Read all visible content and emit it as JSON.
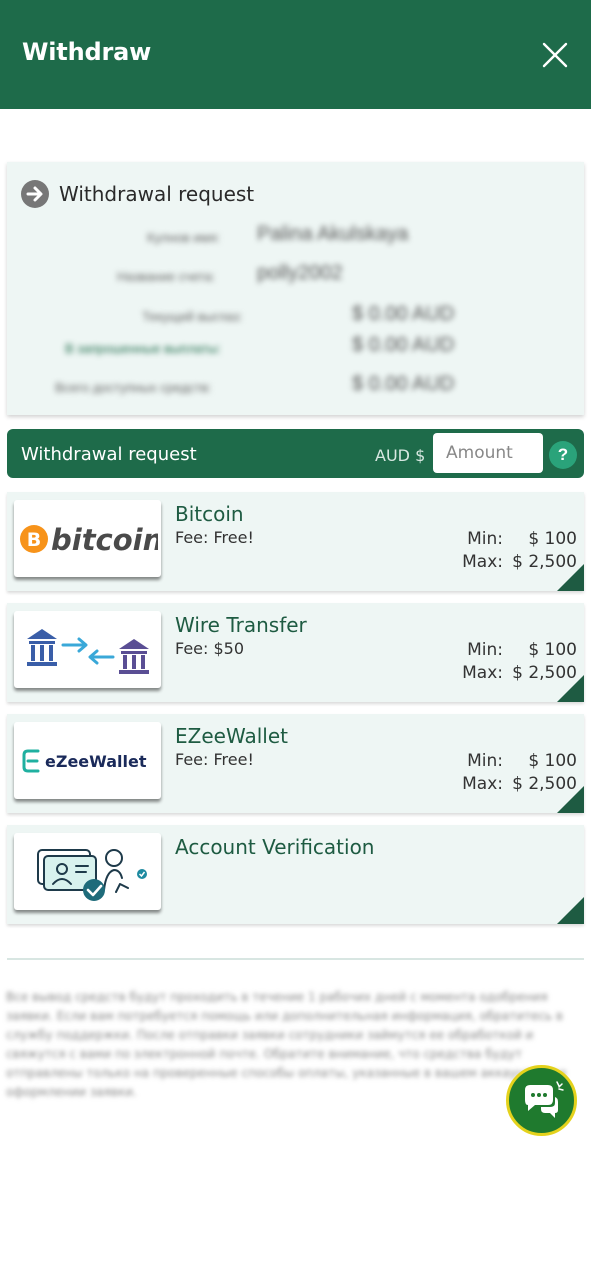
{
  "header": {
    "title": "Withdraw",
    "close_icon": "close-icon"
  },
  "summary": {
    "title": "Withdrawal request",
    "icon": "arrow-right-circle-icon",
    "rows": [
      {
        "label": "Кулнов имя:",
        "value": "Palina Akulskaya"
      },
      {
        "label": "Название счета:",
        "value": "polly2002"
      },
      {
        "label": "Текущий выглаз:",
        "value": "$ 0.00 AUD"
      },
      {
        "label": "В запрошенные выплаты:",
        "value": "$ 0.00 AUD"
      },
      {
        "label": "Всего доступных средств:",
        "value": "$ 0.00 AUD"
      }
    ]
  },
  "request_bar": {
    "label": "Withdrawal request",
    "currency": "AUD $",
    "amount_placeholder": "Amount",
    "help": "?"
  },
  "methods": [
    {
      "name": "Bitcoin",
      "fee": "Fee: Free!",
      "min_label": "Min:",
      "min": "$ 100",
      "max_label": "Max:",
      "max": "$ 2,500",
      "logo": "bitcoin-logo"
    },
    {
      "name": "Wire Transfer",
      "fee": "Fee: $50",
      "min_label": "Min:",
      "min": "$ 100",
      "max_label": "Max:",
      "max": "$ 2,500",
      "logo": "bank-transfer-icon"
    },
    {
      "name": "EZeeWallet",
      "fee": "Fee: Free!",
      "min_label": "Min:",
      "min": "$ 100",
      "max_label": "Max:",
      "max": "$ 2,500",
      "logo": "ezeewallet-logo"
    },
    {
      "name": "Account Verification",
      "logo": "id-verification-icon"
    }
  ],
  "logos": {
    "bitcoin": "bitcoin",
    "ezeewallet": "eZeeWallet"
  },
  "disclaimer": "Все вывод средств будут проходить в течение 1 рабочих дней с момента одобрения заявки. Если вам потребуется помощь или дополнительная информация, обратитесь в службу поддержки. После отправки заявки сотрудники займутся ее обработкой и свяжутся с вами по электронной почте. Обратите внимание, что средства будут отправлены только на проверенные способы оплаты, указанные в вашем аккаунте при оформлении заявки.",
  "chat": {
    "icon": "chat-bubbles-icon"
  },
  "colors": {
    "primary": "#1e6b4a",
    "panel": "#eef6f4",
    "help": "#2aa37a",
    "chat_bg": "#1f7a2e",
    "chat_ring": "#e4d21c"
  }
}
